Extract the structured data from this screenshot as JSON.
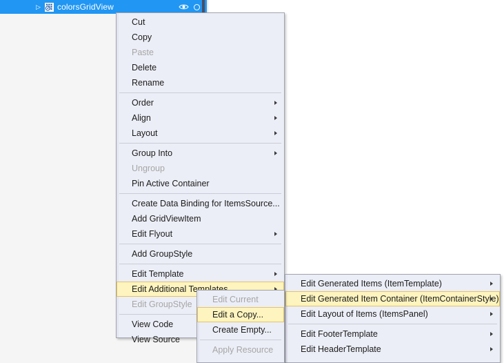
{
  "objects_panel": {
    "selected_item": {
      "label": "colorsGridView",
      "expander_icon": "triangle-right-icon",
      "type_icon": "gridview-icon",
      "visibility_icon": "eye-icon",
      "lock_icon": "circle-icon"
    },
    "selection_color": "#2196f3"
  },
  "context_menu": {
    "highlight_color": "#fdf4bf",
    "background_color": "#eceef7",
    "items": [
      {
        "label": "Cut",
        "enabled": true,
        "submenu": false
      },
      {
        "label": "Copy",
        "enabled": true,
        "submenu": false
      },
      {
        "label": "Paste",
        "enabled": false,
        "submenu": false
      },
      {
        "label": "Delete",
        "enabled": true,
        "submenu": false
      },
      {
        "label": "Rename",
        "enabled": true,
        "submenu": false
      },
      {
        "separator": true
      },
      {
        "label": "Order",
        "enabled": true,
        "submenu": true
      },
      {
        "label": "Align",
        "enabled": true,
        "submenu": true
      },
      {
        "label": "Layout",
        "enabled": true,
        "submenu": true
      },
      {
        "separator": true
      },
      {
        "label": "Group Into",
        "enabled": true,
        "submenu": true
      },
      {
        "label": "Ungroup",
        "enabled": false,
        "submenu": false
      },
      {
        "label": "Pin Active Container",
        "enabled": true,
        "submenu": false
      },
      {
        "separator": true
      },
      {
        "label": "Create Data Binding for ItemsSource...",
        "enabled": true,
        "submenu": false
      },
      {
        "label": "Add GridViewItem",
        "enabled": true,
        "submenu": false
      },
      {
        "label": "Edit Flyout",
        "enabled": true,
        "submenu": true
      },
      {
        "separator": true
      },
      {
        "label": "Add GroupStyle",
        "enabled": true,
        "submenu": false
      },
      {
        "separator": true
      },
      {
        "label": "Edit Template",
        "enabled": true,
        "submenu": true
      },
      {
        "label": "Edit Additional Templates",
        "enabled": true,
        "submenu": true,
        "highlighted": true
      },
      {
        "label": "Edit GroupStyle",
        "enabled": false,
        "submenu": false
      },
      {
        "separator": true
      },
      {
        "label": "View Code",
        "enabled": true,
        "submenu": false
      },
      {
        "label": "View Source",
        "enabled": true,
        "submenu": false
      }
    ]
  },
  "template_submenu": {
    "items": [
      {
        "label": "Edit Generated Items (ItemTemplate)",
        "enabled": true,
        "submenu": true
      },
      {
        "label": "Edit Generated Item Container (ItemContainerStyle)",
        "enabled": true,
        "submenu": true,
        "highlighted": true
      },
      {
        "label": "Edit Layout of Items (ItemsPanel)",
        "enabled": true,
        "submenu": true
      },
      {
        "separator": true
      },
      {
        "label": "Edit FooterTemplate",
        "enabled": true,
        "submenu": true
      },
      {
        "label": "Edit HeaderTemplate",
        "enabled": true,
        "submenu": true
      }
    ]
  },
  "edit_copy_submenu": {
    "items": [
      {
        "label": "Edit Current",
        "enabled": false,
        "submenu": false
      },
      {
        "label": "Edit a Copy...",
        "enabled": true,
        "submenu": false,
        "highlighted": true
      },
      {
        "label": "Create Empty...",
        "enabled": true,
        "submenu": false
      },
      {
        "separator": true
      },
      {
        "label": "Apply Resource",
        "enabled": false,
        "submenu": false
      }
    ]
  }
}
